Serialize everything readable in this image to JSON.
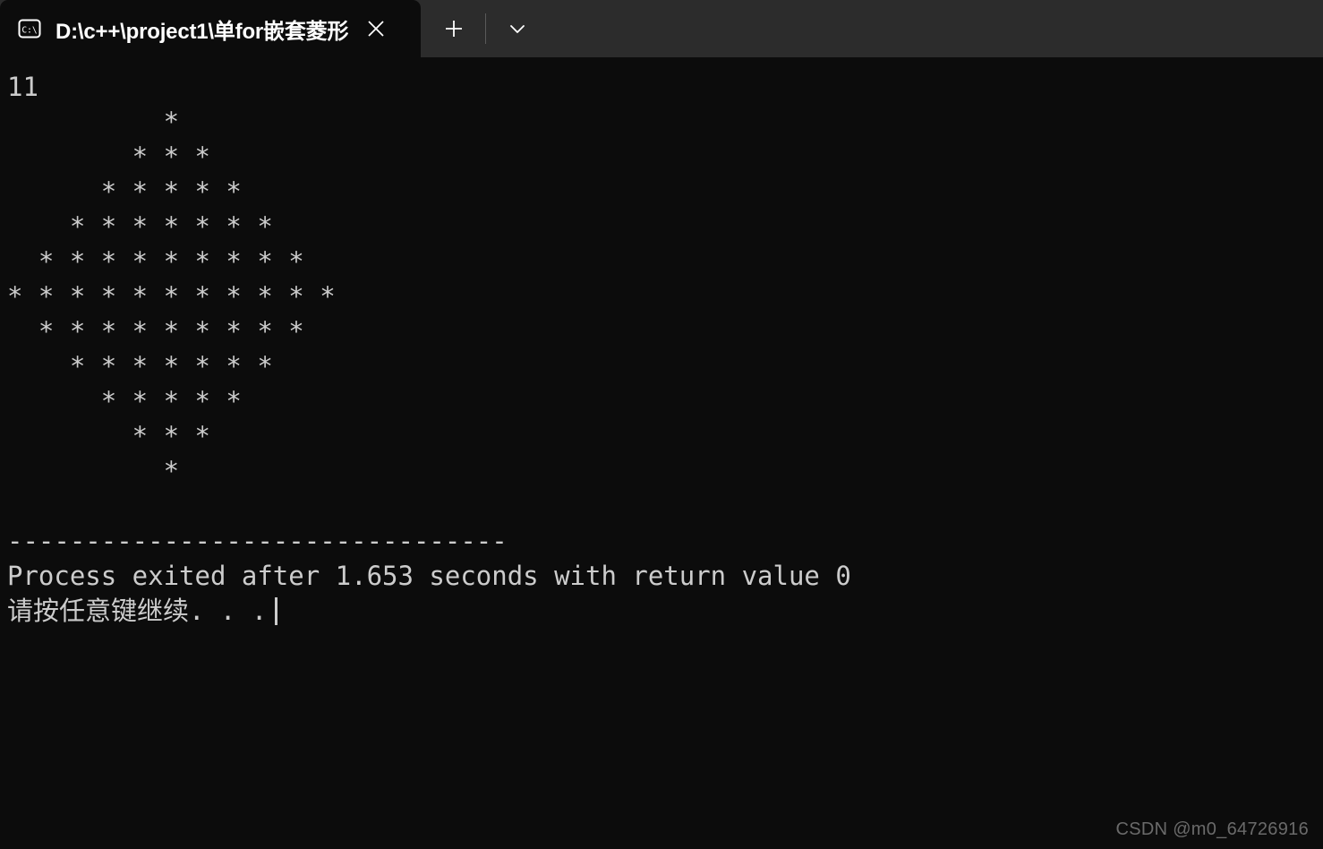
{
  "titlebar": {
    "tab": {
      "icon": "cmd-prompt-icon",
      "title": "D:\\c++\\project1\\单for嵌套菱形",
      "close_label": "✕"
    },
    "new_tab_label": "+",
    "dropdown_label": "⌄"
  },
  "terminal": {
    "lines": [
      "11",
      "          *",
      "        * * *",
      "      * * * * *",
      "    * * * * * * *",
      "  * * * * * * * * *",
      "* * * * * * * * * * *",
      "  * * * * * * * * *",
      "    * * * * * * *",
      "      * * * * *",
      "        * * *",
      "          *",
      "",
      "--------------------------------",
      "Process exited after 1.653 seconds with return value 0",
      "请按任意键继续. . ."
    ],
    "cursor_line_index": 15,
    "text_color": "#cccccc",
    "background_color": "#0c0c0c"
  },
  "watermark": {
    "text": "CSDN @m0_64726916"
  }
}
